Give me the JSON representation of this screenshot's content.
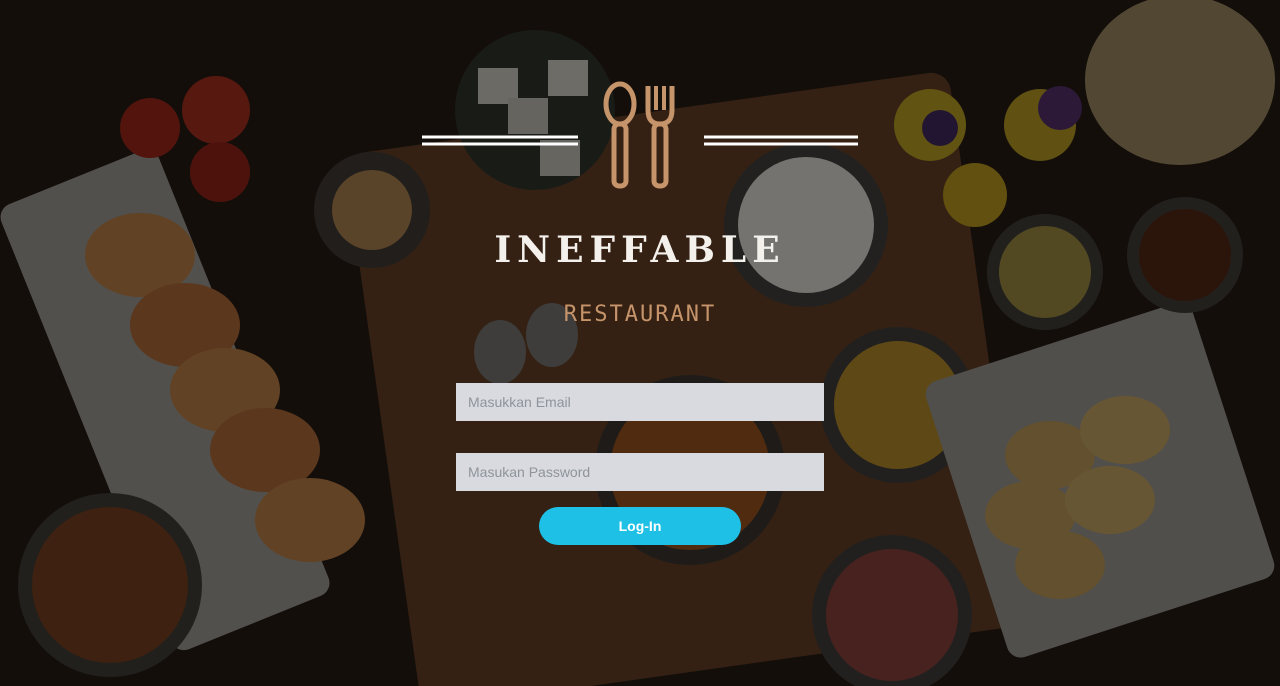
{
  "brand": {
    "name": "INEFFABLE",
    "subtitle": "RESTAURANT"
  },
  "login_form": {
    "email_placeholder": "Masukkan Email",
    "email_value": "",
    "password_placeholder": "Masukan Password",
    "password_value": "",
    "submit_label": "Log-In"
  },
  "colors": {
    "accent_button": "#1ec0e6",
    "logo_utensils": "#c6946a",
    "brand_text": "#f4f1ec",
    "input_background": "#d8dae0"
  },
  "icons": {
    "logo": "spoon-fork-icon"
  }
}
